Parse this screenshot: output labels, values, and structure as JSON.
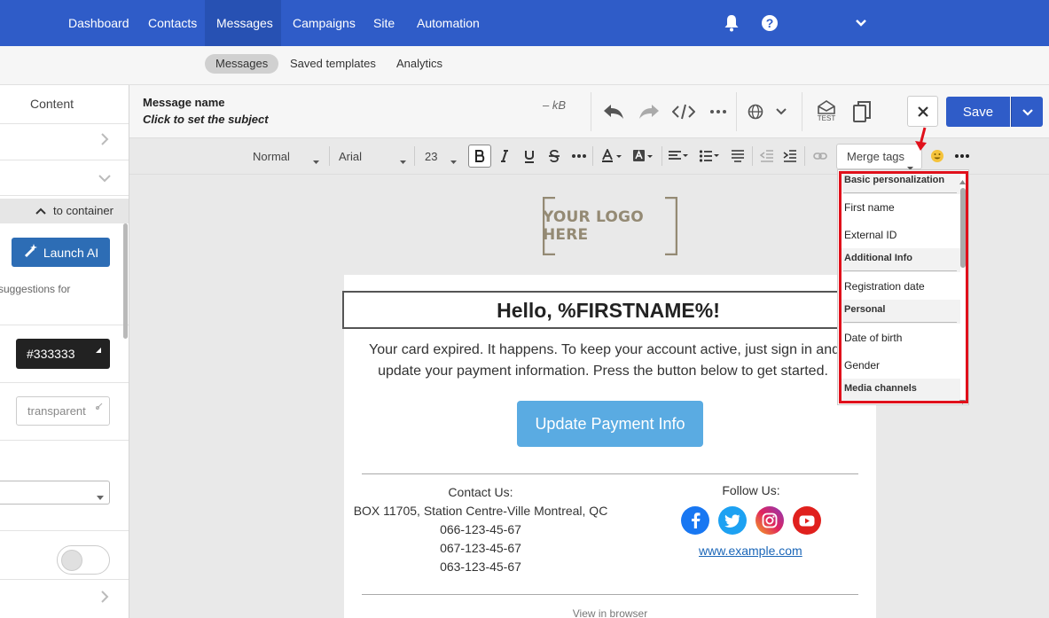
{
  "topnav": {
    "items": [
      "Dashboard",
      "Contacts",
      "Messages",
      "Campaigns",
      "Site",
      "Automation"
    ],
    "active": "Messages"
  },
  "subnav": {
    "items": [
      "Messages",
      "Saved templates",
      "Analytics"
    ],
    "active": "Messages"
  },
  "left_panel": {
    "content_label": "Content",
    "to_container": "to container",
    "launch_ai": "Launch AI",
    "suggestions_text": "suggestions for",
    "color_value": "#333333",
    "background_value": "transparent"
  },
  "editor_header": {
    "message_name": "Message name",
    "subject_placeholder": "Click to set the subject",
    "size": "– kB",
    "test_label": "TEST",
    "save_label": "Save"
  },
  "format_toolbar": {
    "style": "Normal",
    "font": "Arial",
    "size": "23",
    "merge_tags": "Merge tags"
  },
  "merge_menu": {
    "groups": [
      {
        "name": "Basic personalization",
        "items": [
          "First name",
          "External ID"
        ]
      },
      {
        "name": "Additional Info",
        "items": [
          "Registration date"
        ]
      },
      {
        "name": "Personal",
        "items": [
          "Date of birth",
          "Gender"
        ]
      },
      {
        "name": "Media channels",
        "items": []
      }
    ]
  },
  "email": {
    "logo_text": "YOUR LOGO HERE",
    "headline": "Hello, %FIRSTNAME%!",
    "body_line1": "Your card expired. It happens. To keep your account active, just sign in and",
    "body_line2": "update your payment information. Press the button below to get started.",
    "cta": "Update Payment Info",
    "contact_title": "Contact Us:",
    "address": "BOX 11705, Station Centre-Ville Montreal, QC",
    "phones": [
      "066-123-45-67",
      "067-123-45-67",
      "063-123-45-67"
    ],
    "follow_title": "Follow Us:",
    "website": "www.example.com",
    "view_in_browser": "View in browser"
  },
  "colors": {
    "nav_blue": "#2f5cc8",
    "cta_blue": "#5aabe2",
    "highlight_red": "#e0101b",
    "facebook": "#1877f2",
    "twitter": "#1da1f2",
    "instagram": "#c13584",
    "youtube": "#e0201d"
  }
}
